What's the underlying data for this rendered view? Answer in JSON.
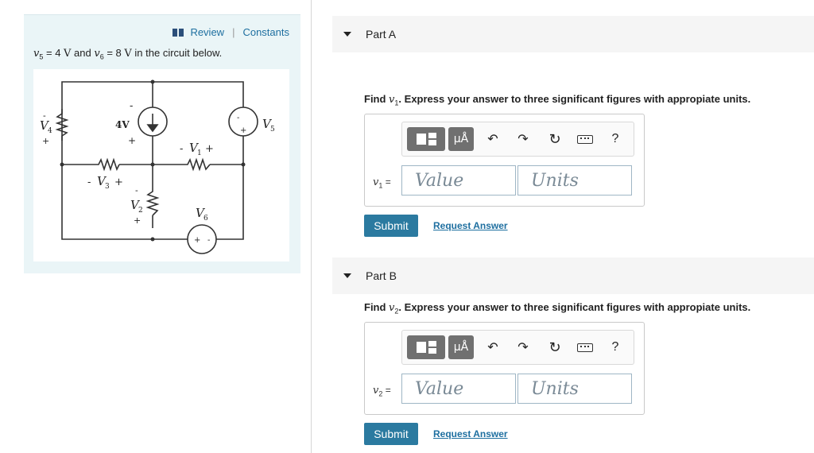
{
  "header": {
    "review_label": "Review",
    "separator": "|",
    "constants_label": "Constants"
  },
  "intro": {
    "v5_sym": "v",
    "v5_sub": "5",
    "v5_eq": " = 4 ",
    "v5_unit": "V",
    "and": " and ",
    "v6_sym": "v",
    "v6_sub": "6",
    "v6_eq": " = 8 ",
    "v6_unit": "V",
    "tail": " in the circuit below."
  },
  "circuit": {
    "source_4v_label": "4V",
    "v1_label": "V",
    "v1_sub": "1",
    "v2_label": "V",
    "v2_sub": "2",
    "v3_label": "V",
    "v3_sub": "3",
    "v4_label": "V",
    "v4_sub": "4",
    "v5_label": "V",
    "v5_sub": "5",
    "v6_label": "V",
    "v6_sub": "6",
    "minus": "-",
    "plus": "+"
  },
  "parts": [
    {
      "title": "Part A",
      "question_prefix": "Find ",
      "var_sym": "v",
      "var_sub": "1",
      "question_suffix": ". Express your answer to three significant figures with appropiate units.",
      "var_label": "v",
      "var_label_sub": "1",
      "eq": " =",
      "value_placeholder": "Value",
      "units_placeholder": "Units",
      "submit_label": "Submit",
      "request_label": "Request Answer"
    },
    {
      "title": "Part B",
      "question_prefix": "Find ",
      "var_sym": "v",
      "var_sub": "2",
      "question_suffix": ". Express your answer to three significant figures with appropiate units.",
      "var_label": "v",
      "var_label_sub": "2",
      "eq": " =",
      "value_placeholder": "Value",
      "units_placeholder": "Units",
      "submit_label": "Submit",
      "request_label": "Request Answer"
    }
  ],
  "toolbar": {
    "units_glyph": "μÅ",
    "undo_glyph": "↶",
    "redo_glyph": "↷",
    "reset_glyph": "↻",
    "help_glyph": "?"
  },
  "colors": {
    "accent": "#2b7aa0",
    "link": "#1e6fa0",
    "panel_bg": "#eaf5f7"
  }
}
